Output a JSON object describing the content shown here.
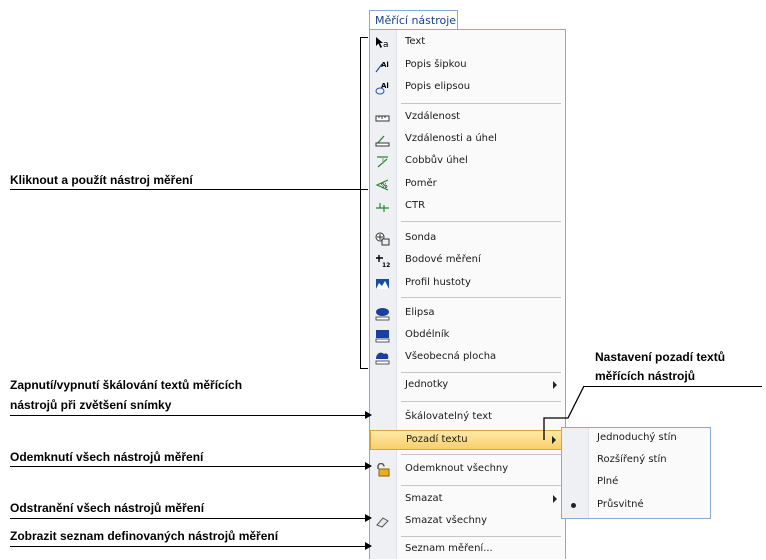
{
  "tab": {
    "label": "Měřící nástroje"
  },
  "menu": {
    "items": [
      {
        "label": "Text",
        "icon": "text-tool-icon"
      },
      {
        "label": "Popis šipkou",
        "icon": "arrow-label-icon"
      },
      {
        "label": "Popis elipsou",
        "icon": "ellipse-label-icon"
      },
      {
        "label": "Vzdálenost",
        "icon": "ruler-icon"
      },
      {
        "label": "Vzdálenosti a úhel",
        "icon": "distance-angle-icon"
      },
      {
        "label": "Cobbův úhel",
        "icon": "cobb-angle-icon"
      },
      {
        "label": "Poměr",
        "icon": "ratio-icon"
      },
      {
        "label": "CTR",
        "icon": "ctr-icon"
      },
      {
        "label": "Sonda",
        "icon": "probe-icon"
      },
      {
        "label": "Bodové měření",
        "icon": "point-measure-icon"
      },
      {
        "label": "Profil hustoty",
        "icon": "density-profile-icon"
      },
      {
        "label": "Elipsa",
        "icon": "ellipse-icon"
      },
      {
        "label": "Obdélník",
        "icon": "rectangle-icon"
      },
      {
        "label": "Všeobecná plocha",
        "icon": "freehand-area-icon"
      },
      {
        "label": "Jednotky",
        "icon": ""
      },
      {
        "label": "Škálovatelný text",
        "icon": ""
      },
      {
        "label": "Pozadí textu",
        "icon": ""
      },
      {
        "label": "Odemknout všechny",
        "icon": "unlock-icon"
      },
      {
        "label": "Smazat",
        "icon": ""
      },
      {
        "label": "Smazat všechny",
        "icon": "eraser-icon"
      },
      {
        "label": "Seznam měření...",
        "icon": ""
      }
    ]
  },
  "submenu": {
    "items": [
      {
        "label": "Jednoduchý stín"
      },
      {
        "label": "Rozšířený stín"
      },
      {
        "label": "Plné"
      },
      {
        "label": "Průsvitné",
        "selected": true
      }
    ]
  },
  "annotations": {
    "click_use": "Kliknout a použít nástroj měření",
    "scaling_1": "Zapnutí/vypnutí škálování textů měřících",
    "scaling_2": "nástrojů při zvětšení snímky",
    "unlock": "Odemknutí všech nástrojů měření",
    "delete": "Odstranění všech nástrojů měření",
    "list": "Zobrazit seznam definovaných nástrojů měření",
    "background_1": "Nastavení pozadí textů",
    "background_2": "měřících nástrojů"
  },
  "colors": {
    "highlight": "#f8cf6a",
    "menu_border": "#8aa9d6",
    "gutter": "#eef0f4"
  }
}
